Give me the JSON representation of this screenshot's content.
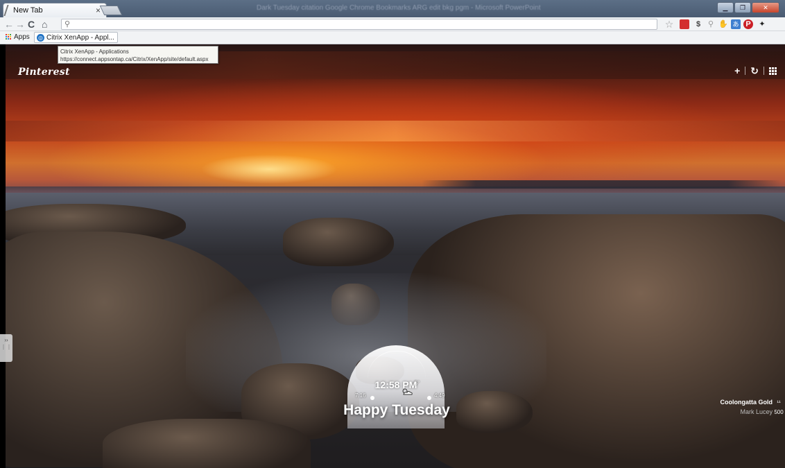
{
  "browser": {
    "tab_title": "New Tab",
    "tab_close": "×",
    "window_title": "Dark Tuesday citation Google Chrome Bookmarks ARG edit bkg pgm - Microsoft PowerPoint",
    "window_controls": {
      "minimize": "▁",
      "restore": "❐",
      "close": "✕"
    },
    "omnibox": {
      "value": "",
      "placeholder": ""
    },
    "nav_icons": [
      "back-arrow",
      "forward-arrow",
      "reload",
      "home",
      "search"
    ],
    "extension_icons": [
      "star",
      "bookmark-red",
      "dollar",
      "pin-grey",
      "hand",
      "translate",
      "pinterest",
      "feather"
    ]
  },
  "bookmarks_bar": {
    "apps_label": "Apps",
    "items": [
      {
        "label": "Citrix XenApp - Appl..."
      }
    ]
  },
  "tooltip": {
    "title": "Citrix XenApp - Applications",
    "url": "https://connect.appsontap.ca/Citrix/XenApp/site/default.aspx"
  },
  "newtab": {
    "brand": "Pinterest",
    "top_actions": [
      "+",
      "↻",
      "grid"
    ],
    "sunrise": "7:16",
    "sunset": "4:49",
    "temperature": "-5°",
    "time": "12:58 PM",
    "greeting": "Happy Tuesday",
    "photo": {
      "place": "Coolongatta Gold",
      "author": "Mark Lucey",
      "side_icons": [
        "¹¹",
        "500"
      ]
    },
    "side_panel_icons": [
      "››",
      "⋮⋮"
    ]
  },
  "colors": {
    "chrome_frame": "#4a5b72",
    "toolbar_bg": "#f1f3f5",
    "sunset_orange": "#d0702e",
    "pinterest_red": "#cb2027"
  }
}
